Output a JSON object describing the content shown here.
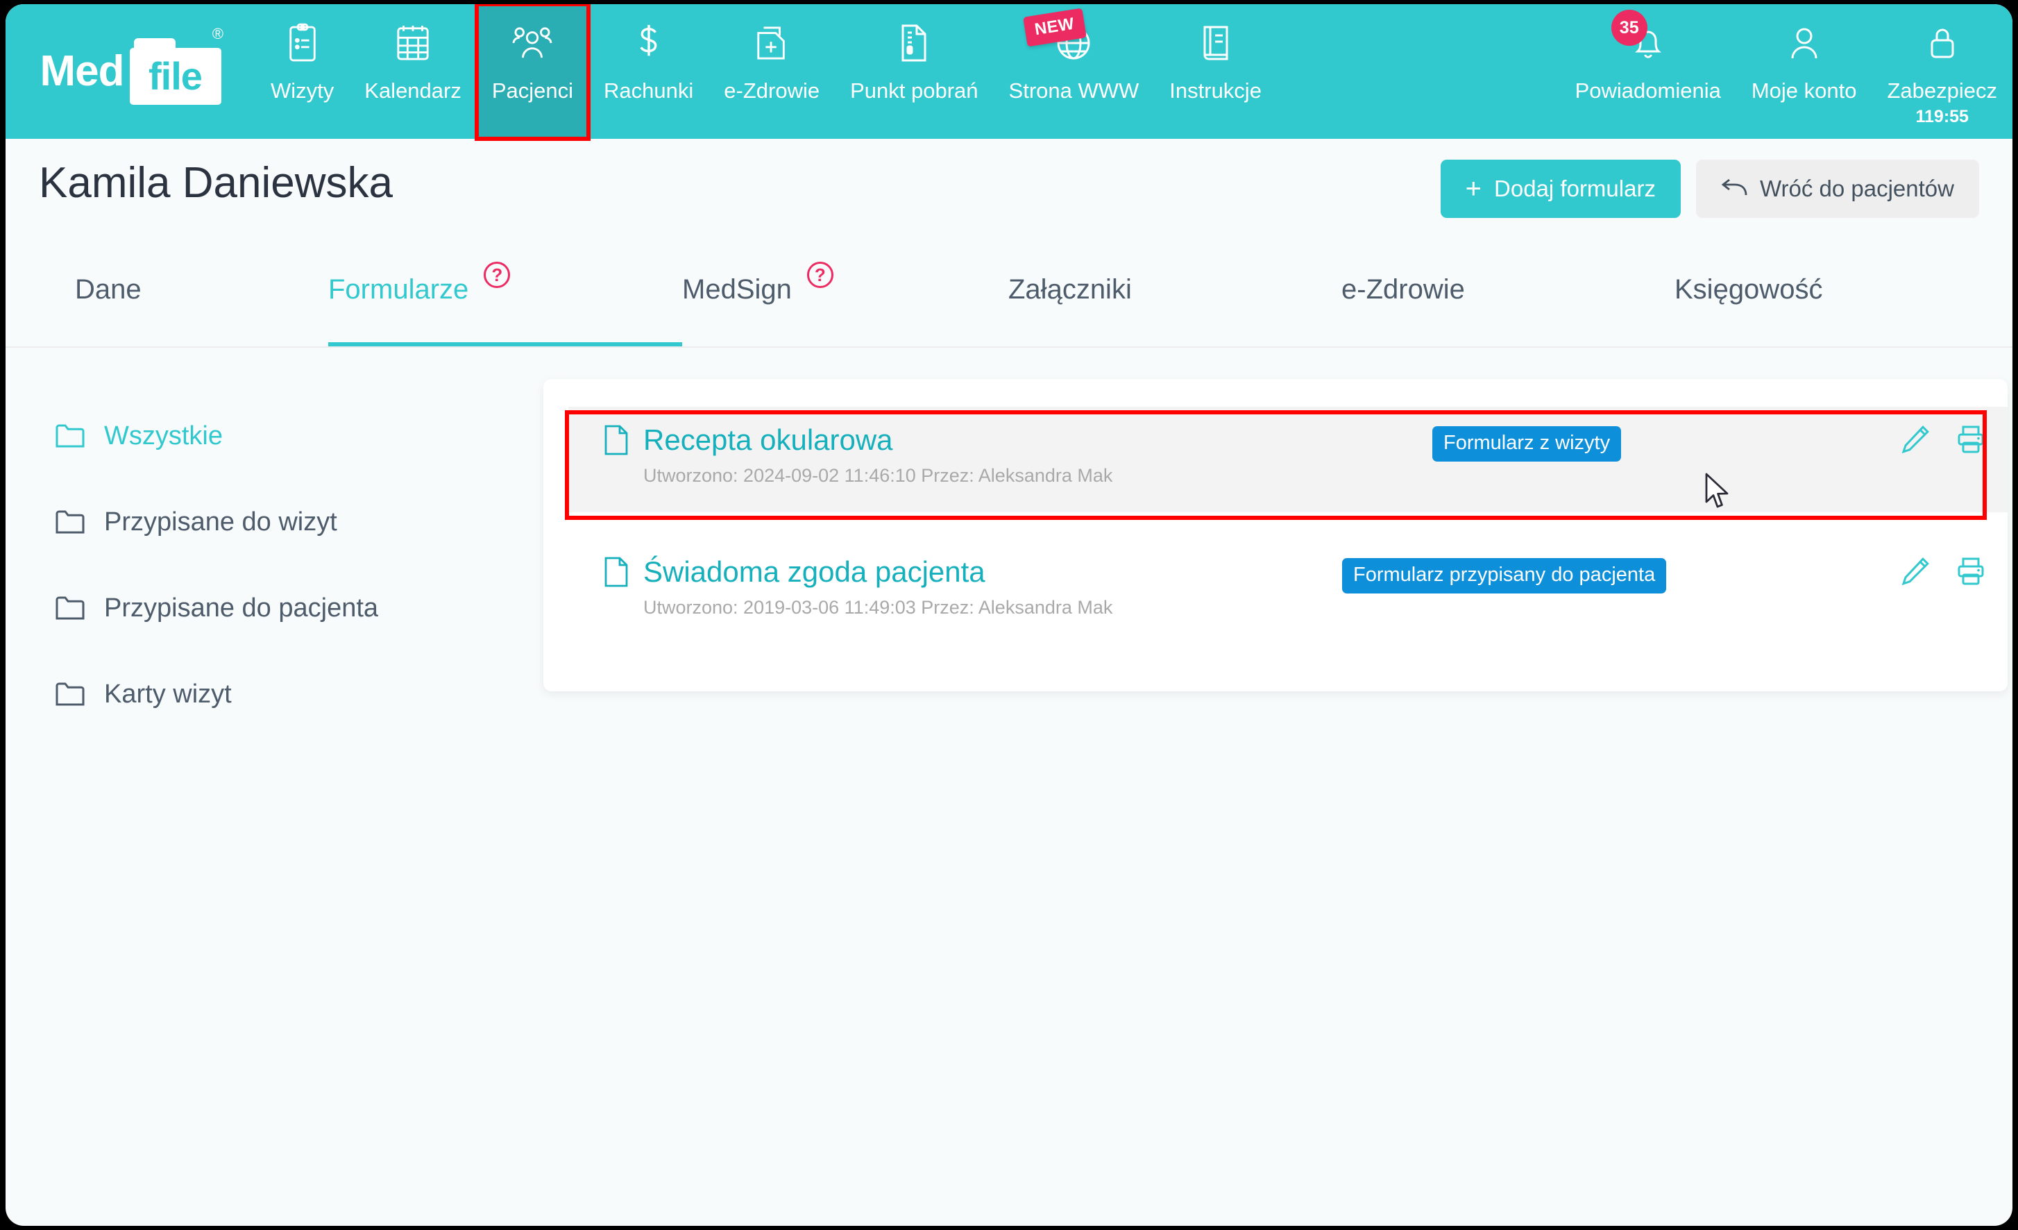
{
  "brand": {
    "word1": "Med",
    "word2": "file",
    "registered": "®"
  },
  "topnav": {
    "items": [
      {
        "label": "Wizyty",
        "icon": "clipboard-icon",
        "active": false
      },
      {
        "label": "Kalendarz",
        "icon": "calendar-icon",
        "active": false
      },
      {
        "label": "Pacjenci",
        "icon": "users-icon",
        "active": true,
        "highlighted": true
      },
      {
        "label": "Rachunki",
        "icon": "dollar-icon",
        "active": false
      },
      {
        "label": "e-Zdrowie",
        "icon": "medical-documents-icon",
        "active": false
      },
      {
        "label": "Punkt pobrań",
        "icon": "lab-document-icon",
        "active": false
      },
      {
        "label": "Strona WWW",
        "icon": "globe-icon",
        "badge": "NEW",
        "active": false
      },
      {
        "label": "Instrukcje",
        "icon": "book-icon",
        "active": false
      }
    ],
    "right_items": [
      {
        "label": "Powiadomienia",
        "icon": "bell-icon",
        "count": "35"
      },
      {
        "label": "Moje konto",
        "icon": "user-icon"
      },
      {
        "label": "Zabezpiecz",
        "icon": "lock-icon",
        "sub": "119:55"
      }
    ]
  },
  "header": {
    "patient_name": "Kamila Daniewska",
    "add_form_button": "Dodaj formularz",
    "add_form_plus": "+",
    "back_button": "Wróć do pacjentów"
  },
  "tabs": [
    {
      "label": "Dane",
      "active": false,
      "help": false
    },
    {
      "label": "Formularze",
      "active": true,
      "help": true
    },
    {
      "label": "MedSign",
      "active": false,
      "help": true
    },
    {
      "label": "Załączniki",
      "active": false,
      "help": false
    },
    {
      "label": "e-Zdrowie",
      "active": false,
      "help": false
    },
    {
      "label": "Księgowość",
      "active": false,
      "help": false
    }
  ],
  "help_glyph": "?",
  "sidebar": {
    "items": [
      {
        "label": "Wszystkie",
        "active": true
      },
      {
        "label": "Przypisane do wizyt",
        "active": false
      },
      {
        "label": "Przypisane do pacjenta",
        "active": false
      },
      {
        "label": "Karty wizyt",
        "active": false
      }
    ]
  },
  "forms": [
    {
      "title": "Recepta okularowa",
      "meta": "Utworzono: 2024-09-02 11:46:10  Przez: Aleksandra Mak",
      "tag": "Formularz z wizyty",
      "selected": true
    },
    {
      "title": "Świadoma zgoda pacjenta",
      "meta": "Utworzono: 2019-03-06 11:49:03  Przez: Aleksandra Mak",
      "tag": "Formularz przypisany do pacjenta",
      "selected": false
    }
  ],
  "colors": {
    "brand_teal": "#31c8ce",
    "nav_active": "#2aadb3",
    "accent_pink": "#ec2b63",
    "tag_blue": "#0d8fd9",
    "highlight_red": "#ff0000",
    "link_teal": "#16b0bd",
    "page_bg": "#f8fbfc",
    "text_dark": "#4d5b6b",
    "meta_gray": "#a9a9a9"
  }
}
